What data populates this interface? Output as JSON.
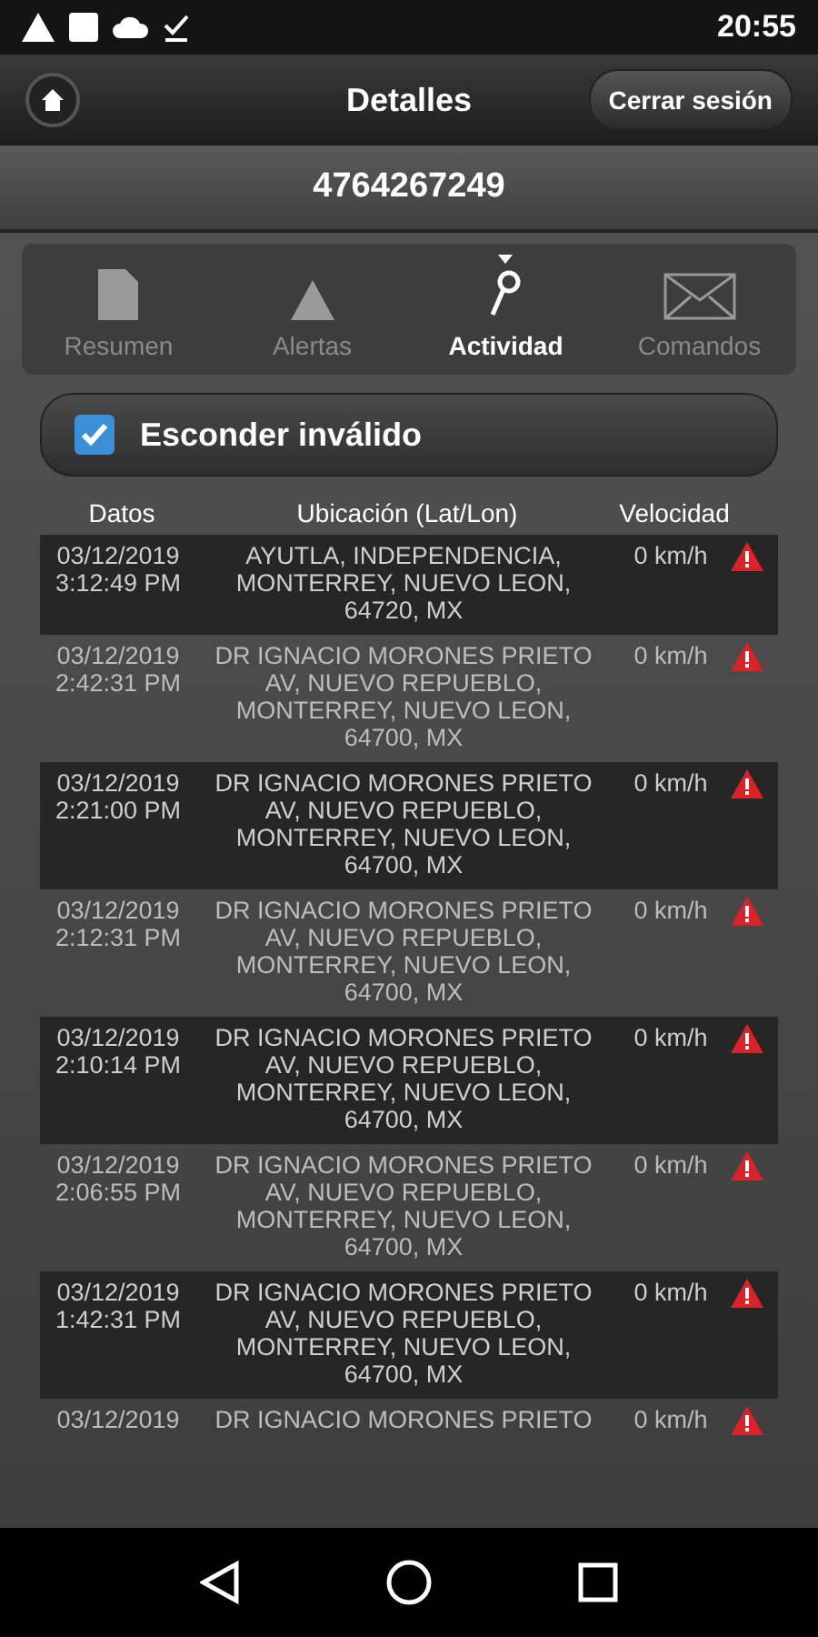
{
  "status_bar": {
    "time": "20:55"
  },
  "header": {
    "title": "Detalles",
    "logout_button": "Cerrar sesión"
  },
  "device_id": "4764267249",
  "tabs": [
    {
      "label": "Resumen",
      "selected": false
    },
    {
      "label": "Alertas",
      "selected": false
    },
    {
      "label": "Actividad",
      "selected": true
    },
    {
      "label": "Comandos",
      "selected": false
    }
  ],
  "filter": {
    "label": "Esconder inválido",
    "checked": true
  },
  "table": {
    "columns": [
      "Datos",
      "Ubicación (Lat/Lon)",
      "Velocidad"
    ],
    "rows": [
      {
        "date": "03/12/2019",
        "time": "3:12:49 PM",
        "address": [
          "AYUTLA, INDEPENDENCIA,",
          "MONTERREY, NUEVO LEON,",
          "64720, MX"
        ],
        "speed": "0 km/h",
        "alert": true
      },
      {
        "date": "03/12/2019",
        "time": "2:42:31 PM",
        "address": [
          "DR IGNACIO MORONES PRIETO",
          "AV, NUEVO REPUEBLO,",
          "MONTERREY, NUEVO LEON,",
          "64700, MX"
        ],
        "speed": "0 km/h",
        "alert": true
      },
      {
        "date": "03/12/2019",
        "time": "2:21:00 PM",
        "address": [
          "DR IGNACIO MORONES PRIETO",
          "AV, NUEVO REPUEBLO,",
          "MONTERREY, NUEVO LEON,",
          "64700, MX"
        ],
        "speed": "0 km/h",
        "alert": true
      },
      {
        "date": "03/12/2019",
        "time": "2:12:31 PM",
        "address": [
          "DR IGNACIO MORONES PRIETO",
          "AV, NUEVO REPUEBLO,",
          "MONTERREY, NUEVO LEON,",
          "64700, MX"
        ],
        "speed": "0 km/h",
        "alert": true
      },
      {
        "date": "03/12/2019",
        "time": "2:10:14 PM",
        "address": [
          "DR IGNACIO MORONES PRIETO",
          "AV, NUEVO REPUEBLO,",
          "MONTERREY, NUEVO LEON,",
          "64700, MX"
        ],
        "speed": "0 km/h",
        "alert": true
      },
      {
        "date": "03/12/2019",
        "time": "2:06:55 PM",
        "address": [
          "DR IGNACIO MORONES PRIETO",
          "AV, NUEVO REPUEBLO,",
          "MONTERREY, NUEVO LEON,",
          "64700, MX"
        ],
        "speed": "0 km/h",
        "alert": true
      },
      {
        "date": "03/12/2019",
        "time": "1:42:31 PM",
        "address": [
          "DR IGNACIO MORONES PRIETO",
          "AV, NUEVO REPUEBLO,",
          "MONTERREY, NUEVO LEON,",
          "64700, MX"
        ],
        "speed": "0 km/h",
        "alert": true
      },
      {
        "date": "03/12/2019",
        "address": [
          "DR IGNACIO MORONES PRIETO"
        ],
        "speed": "0 km/h",
        "alert": true
      }
    ]
  }
}
